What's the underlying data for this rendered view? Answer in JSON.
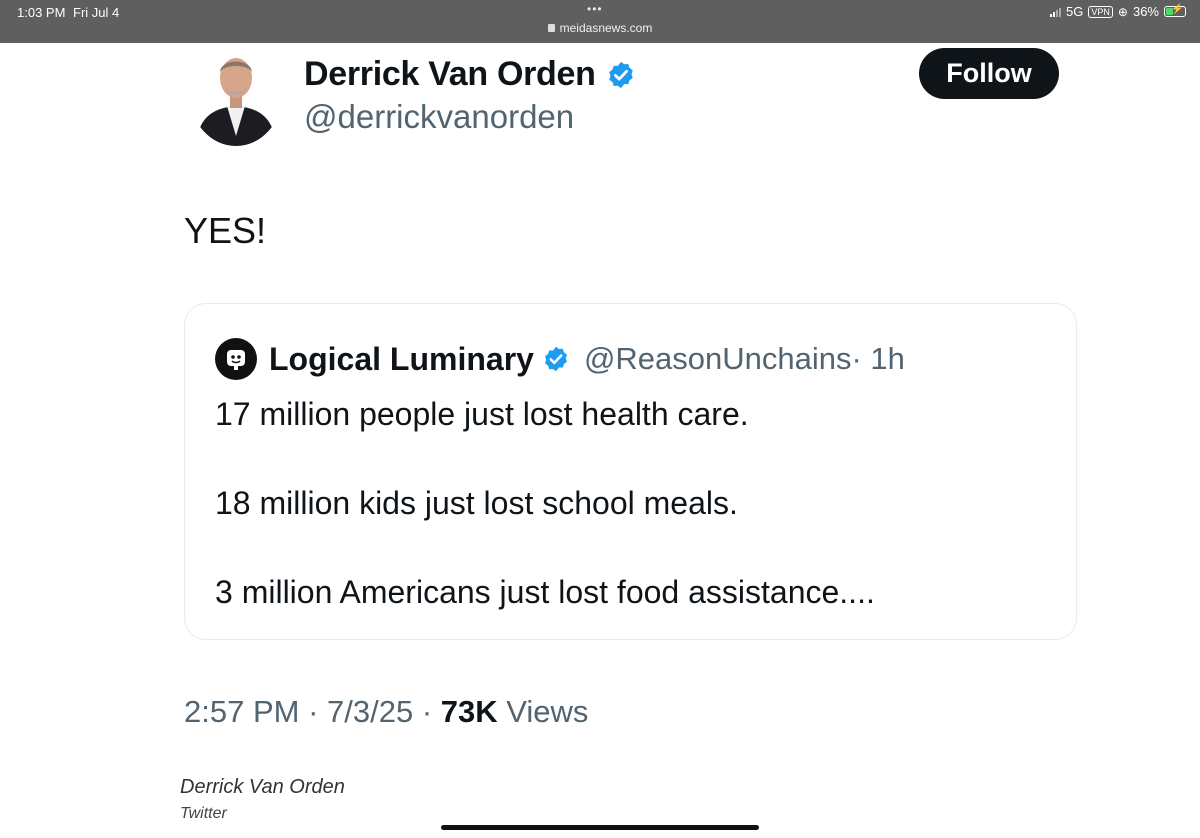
{
  "status_bar": {
    "time": "1:03 PM",
    "date": "Fri Jul 4",
    "dots": "•••",
    "url": "meidasnews.com",
    "network": "5G",
    "vpn": "VPN",
    "battery": "36%",
    "battery_level": 0.36
  },
  "tweet": {
    "author_name": "Derrick Van Orden",
    "author_handle": "@derrickvanorden",
    "follow_label": "Follow",
    "text": "YES!",
    "quote": {
      "author_name": "Logical Luminary",
      "author_handle": "@ReasonUnchains",
      "time": "· 1h",
      "lines": [
        "17 million people just lost health care.",
        "18 million kids just lost school meals.",
        "3 million Americans just lost food assistance...."
      ]
    },
    "meta": {
      "time": "2:57 PM",
      "date": "7/3/25",
      "views_count": "73K",
      "views_label": "Views"
    }
  },
  "caption": {
    "name": "Derrick Van Orden",
    "source": "Twitter"
  },
  "colors": {
    "verified": "#1d9bf0",
    "status_bar": "#5f5f5f",
    "secondary_text": "#536471"
  }
}
